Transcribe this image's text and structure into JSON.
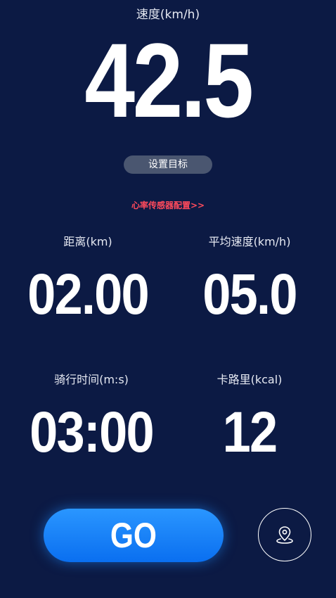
{
  "speed": {
    "label": "速度(km/h)",
    "value": "42.5"
  },
  "goal_button": {
    "label": "设置目标"
  },
  "heart_rate_link": {
    "label": "心率传感器配置>>"
  },
  "stats": {
    "distance": {
      "label": "距离(km)",
      "value": "02.00"
    },
    "avg_speed": {
      "label": "平均速度(km/h)",
      "value": "05.0"
    },
    "ride_time": {
      "label": "骑行时间(m:s)",
      "value": "03:00"
    },
    "calories": {
      "label": "卡路里(kcal)",
      "value": "12"
    }
  },
  "go_button": {
    "label": "GO"
  },
  "map_button": {
    "icon": "map-pin-icon"
  },
  "colors": {
    "background": "#0c1a44",
    "accent": "#1a82ff",
    "link": "#ff4a5c",
    "goal_button_bg": "#4a5670"
  }
}
